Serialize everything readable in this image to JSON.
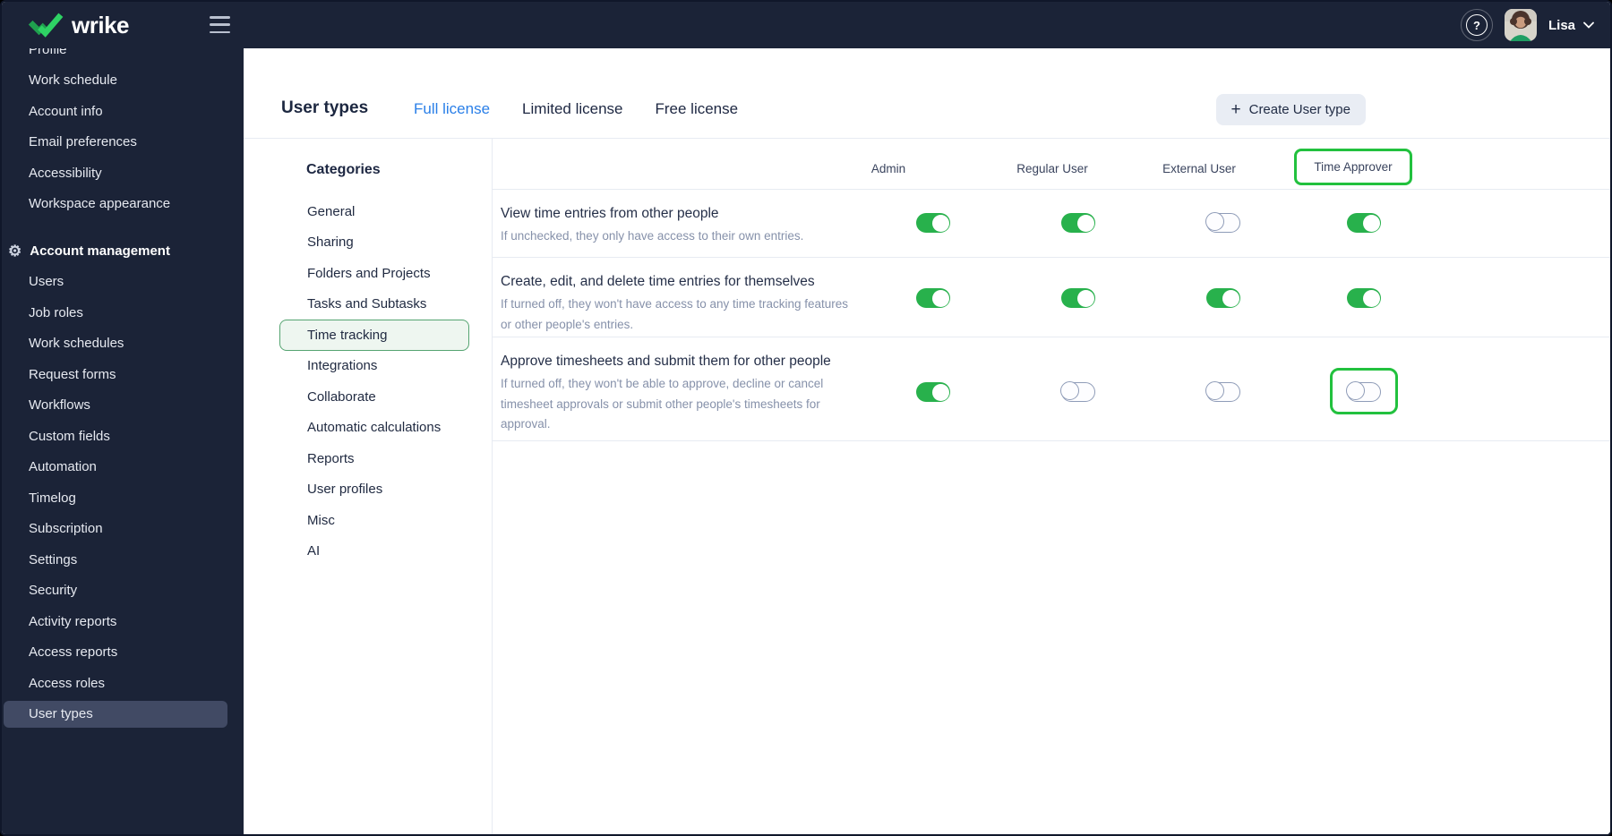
{
  "topbar": {
    "brand": "wrike",
    "help_icon": "?",
    "user_name": "Lisa"
  },
  "sidebar": {
    "items_top": [
      "Profile",
      "Work schedule",
      "Account info",
      "Email preferences",
      "Accessibility",
      "Workspace appearance"
    ],
    "section_label": "Account management",
    "items": [
      "Users",
      "Job roles",
      "Work schedules",
      "Request forms",
      "Workflows",
      "Custom fields",
      "Automation",
      "Timelog",
      "Subscription",
      "Settings",
      "Security",
      "Activity reports",
      "Access reports",
      "Access roles",
      "User types"
    ],
    "selected": "User types"
  },
  "header": {
    "title": "User types",
    "tabs": [
      "Full license",
      "Limited license",
      "Free license"
    ],
    "active_tab": "Full license",
    "create_button_label": "Create User type",
    "create_button_plus": "+"
  },
  "categories": {
    "title": "Categories",
    "items": [
      "General",
      "Sharing",
      "Folders and Projects",
      "Tasks and Subtasks",
      "Time tracking",
      "Integrations",
      "Collaborate",
      "Automatic calculations",
      "Reports",
      "User profiles",
      "Misc",
      "AI"
    ],
    "selected": "Time tracking"
  },
  "permissions_table": {
    "columns": [
      "Admin",
      "Regular User",
      "External User",
      "Time Approver"
    ],
    "highlighted_column": "Time Approver",
    "rows": [
      {
        "title": "View time entries from other people",
        "description": "If unchecked, they only have access to their own entries.",
        "toggles": [
          true,
          true,
          false,
          true
        ]
      },
      {
        "title": "Create, edit, and delete time entries for themselves",
        "description": "If turned off, they won't have access to any time tracking features or other people's entries.",
        "toggles": [
          true,
          true,
          true,
          true
        ]
      },
      {
        "title": "Approve timesheets and submit them for other people",
        "description": "If turned off, they won't be able to approve, decline or cancel timesheet approvals or submit other people's timesheets for approval.",
        "toggles": [
          true,
          false,
          false,
          false
        ],
        "highlighted_toggle_column": "Time Approver"
      }
    ]
  },
  "colors": {
    "navy": "#1b2337",
    "selected_nav_bg": "#414a64",
    "accent_green": "#22c13e",
    "toggle_on": "#28b14c",
    "tab_active_blue": "#2a7fe8",
    "category_selected_bg": "#eef6f0",
    "category_selected_border": "#55a471",
    "divider": "#e7ebf2",
    "text_dark": "#1c2740",
    "text_muted": "#8691aa",
    "button_bg": "#e9edf4"
  }
}
